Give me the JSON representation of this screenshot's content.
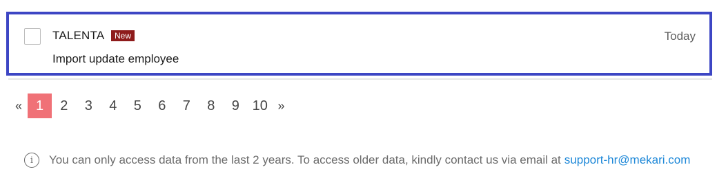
{
  "message": {
    "sender": "TALENTA",
    "badge": "New",
    "date": "Today",
    "subject": "Import update employee",
    "checked": false
  },
  "pagination": {
    "prev_label": "«",
    "next_label": "»",
    "pages": [
      "1",
      "2",
      "3",
      "4",
      "5",
      "6",
      "7",
      "8",
      "9",
      "10"
    ],
    "current": "1"
  },
  "footer": {
    "info_icon": "info-icon",
    "notice": "You can only access data from the last 2 years. To access older data, kindly contact us via email at",
    "email": "support-hr@mekari.com"
  },
  "colors": {
    "selection_border": "#3d46c4",
    "badge_bg": "#8e1b1b",
    "active_page": "#f07177",
    "link": "#1e88d8"
  }
}
